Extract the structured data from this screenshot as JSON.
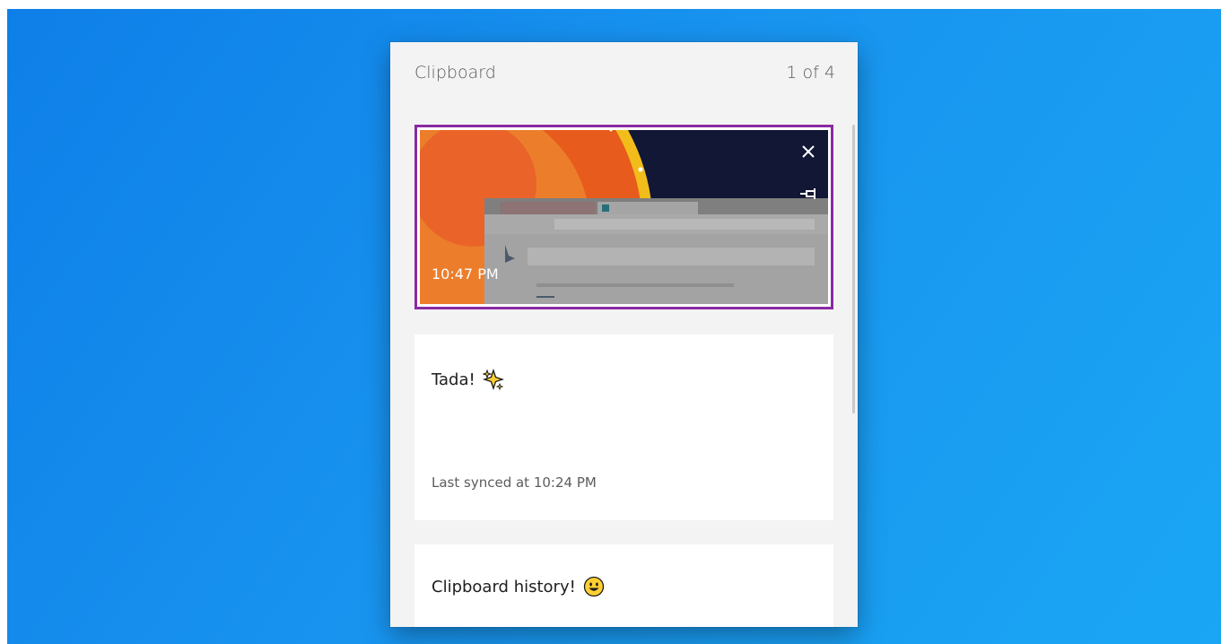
{
  "clipboard": {
    "title": "Clipboard",
    "count": "1 of 4"
  },
  "items": [
    {
      "type": "image",
      "timestamp": "10:47 PM",
      "icons": [
        "close-icon",
        "pin-icon"
      ]
    },
    {
      "type": "text",
      "text": "Tada!",
      "emoji": "sparkles-icon",
      "status": "Last synced at 10:24 PM"
    },
    {
      "type": "text",
      "text": "Clipboard history!",
      "emoji": "smiley-icon"
    }
  ],
  "colors": {
    "desktop": "#1893ef",
    "panel": "#f3f3f3",
    "selection": "#8a2aa4"
  }
}
